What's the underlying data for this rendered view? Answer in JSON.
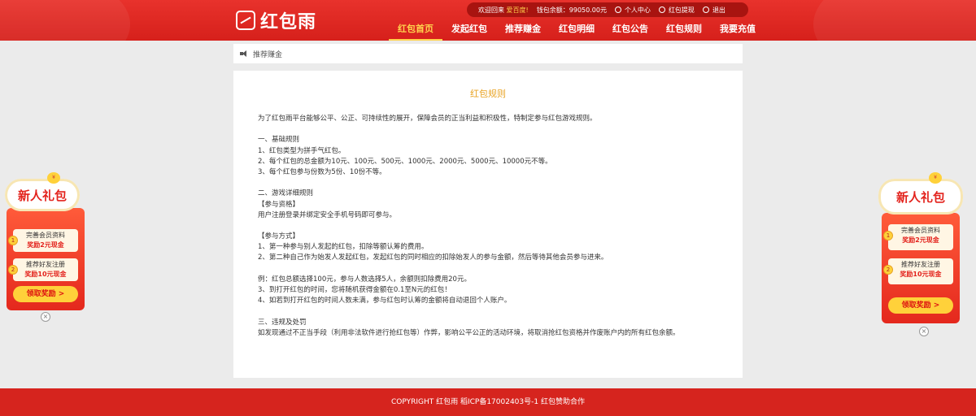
{
  "brand": {
    "name": "红包雨"
  },
  "userbar": {
    "welcome": "欢迎回来",
    "username": "爱百度!",
    "balance_label": "钱包余额：",
    "balance_value": "99050.00元",
    "user_center": "个人中心",
    "withdraw": "红包提现",
    "logout": "退出"
  },
  "nav": [
    {
      "label": "红包首页",
      "active": true
    },
    {
      "label": "发起红包"
    },
    {
      "label": "推荐赚金"
    },
    {
      "label": "红包明细"
    },
    {
      "label": "红包公告"
    },
    {
      "label": "红包规则"
    },
    {
      "label": "我要充值"
    }
  ],
  "breadcrumb": {
    "label": "推荐赚金"
  },
  "rules": {
    "title": "红包规则",
    "lines": [
      "为了红包雨平台能够公平、公正、可持续性的展开，保障会员的正当利益和积极性，特制定参与红包游戏规则。",
      "",
      "一、基础规则",
      "1、红包类型为拼手气红包。",
      "2、每个红包的总金额为10元、100元、500元、1000元、2000元、5000元、10000元不等。",
      "3、每个红包参与份数为5份、10份不等。",
      "",
      "二、游戏详细规则",
      "【参与资格】",
      "用户注册登录并绑定安全手机号码即可参与。",
      "",
      "【参与方式】",
      "1、第一种参与别人发起的红包，扣除等额认筹的费用。",
      "2、第二种自己作为始发人发起红包，发起红包的同时相应的扣除始发人的参与金额，然后等待其他会员参与进来。",
      "",
      "例：红包总额选择100元，参与人数选择5人，余额则扣除费用20元。",
      "3、到打开红包的时间，您将随机获得金额在0.1至N元的红包！",
      "4、如若到打开红包的时间人数未满，参与红包时认筹的金额将自动退回个人账户。",
      "",
      "三、违规及处罚",
      "如发现通过不正当手段（利用非法软件进行抢红包等）作弊，影响公平公正的活动环境，将取消抢红包资格并作废账户内的所有红包余额。"
    ]
  },
  "promo": {
    "badge": "新人礼包",
    "coin": "¥",
    "item1_line1": "完善会员资料",
    "item1_line2": "奖励2元现金",
    "item2_line1": "推荐好友注册",
    "item2_line2": "奖励10元现金",
    "num1": "1",
    "num2": "2",
    "button": "领取奖励 >",
    "close": "×"
  },
  "footer": {
    "text": "COPYRIGHT 红包雨 稻ICP备17002403号-1 红包赞助合作"
  },
  "colors": {
    "header_red": "#d6201b",
    "accent_gold": "#ffd24d",
    "title_orange": "#e8a323",
    "footer_red": "#d6241e"
  }
}
